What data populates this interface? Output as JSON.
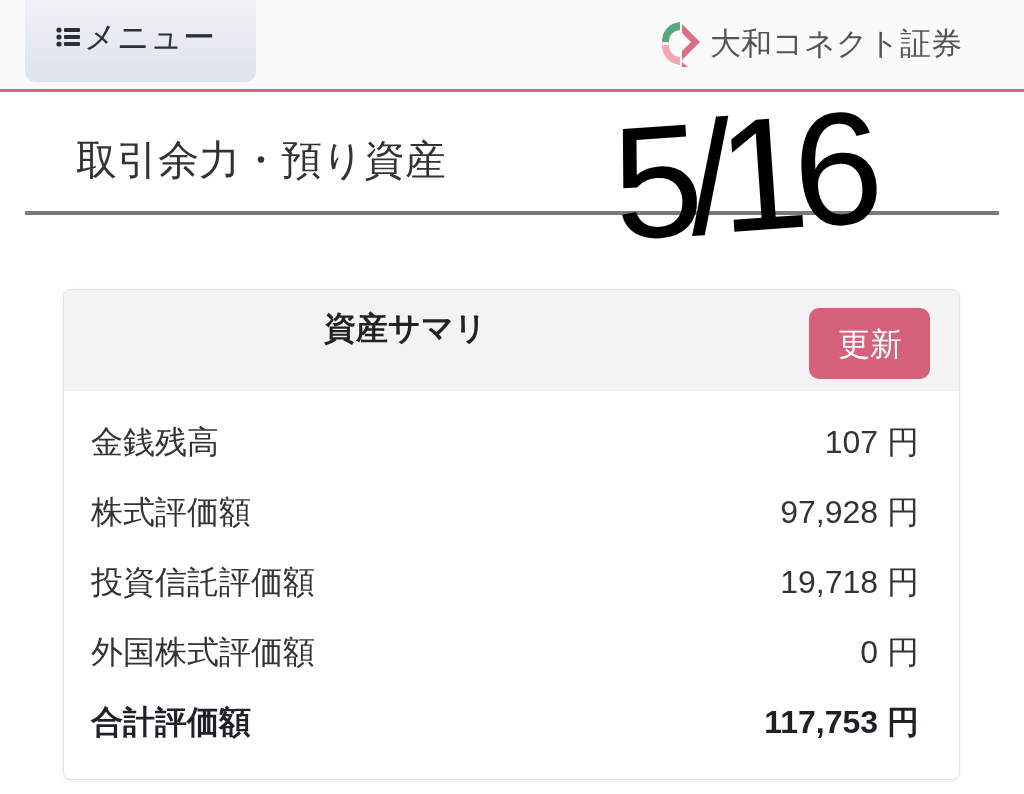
{
  "header": {
    "menu_button": {
      "label": "メニュー"
    },
    "brand": {
      "name": "大和コネクト証券"
    }
  },
  "page_title": "取引余力・預り資産",
  "handwritten_note": "5/16",
  "summary_card": {
    "title": "資産サマリ",
    "refresh_button": "更新",
    "rows": [
      {
        "label": "金銭残高",
        "value": "107 円",
        "kind": "item"
      },
      {
        "label": "株式評価額",
        "value": "97,928 円",
        "kind": "item"
      },
      {
        "label": "投資信託評価額",
        "value": "19,718 円",
        "kind": "item"
      },
      {
        "label": "外国株式評価額",
        "value": "0 円",
        "kind": "item"
      },
      {
        "label": "合計評価額",
        "value": "117,753 円",
        "kind": "total"
      }
    ]
  }
}
